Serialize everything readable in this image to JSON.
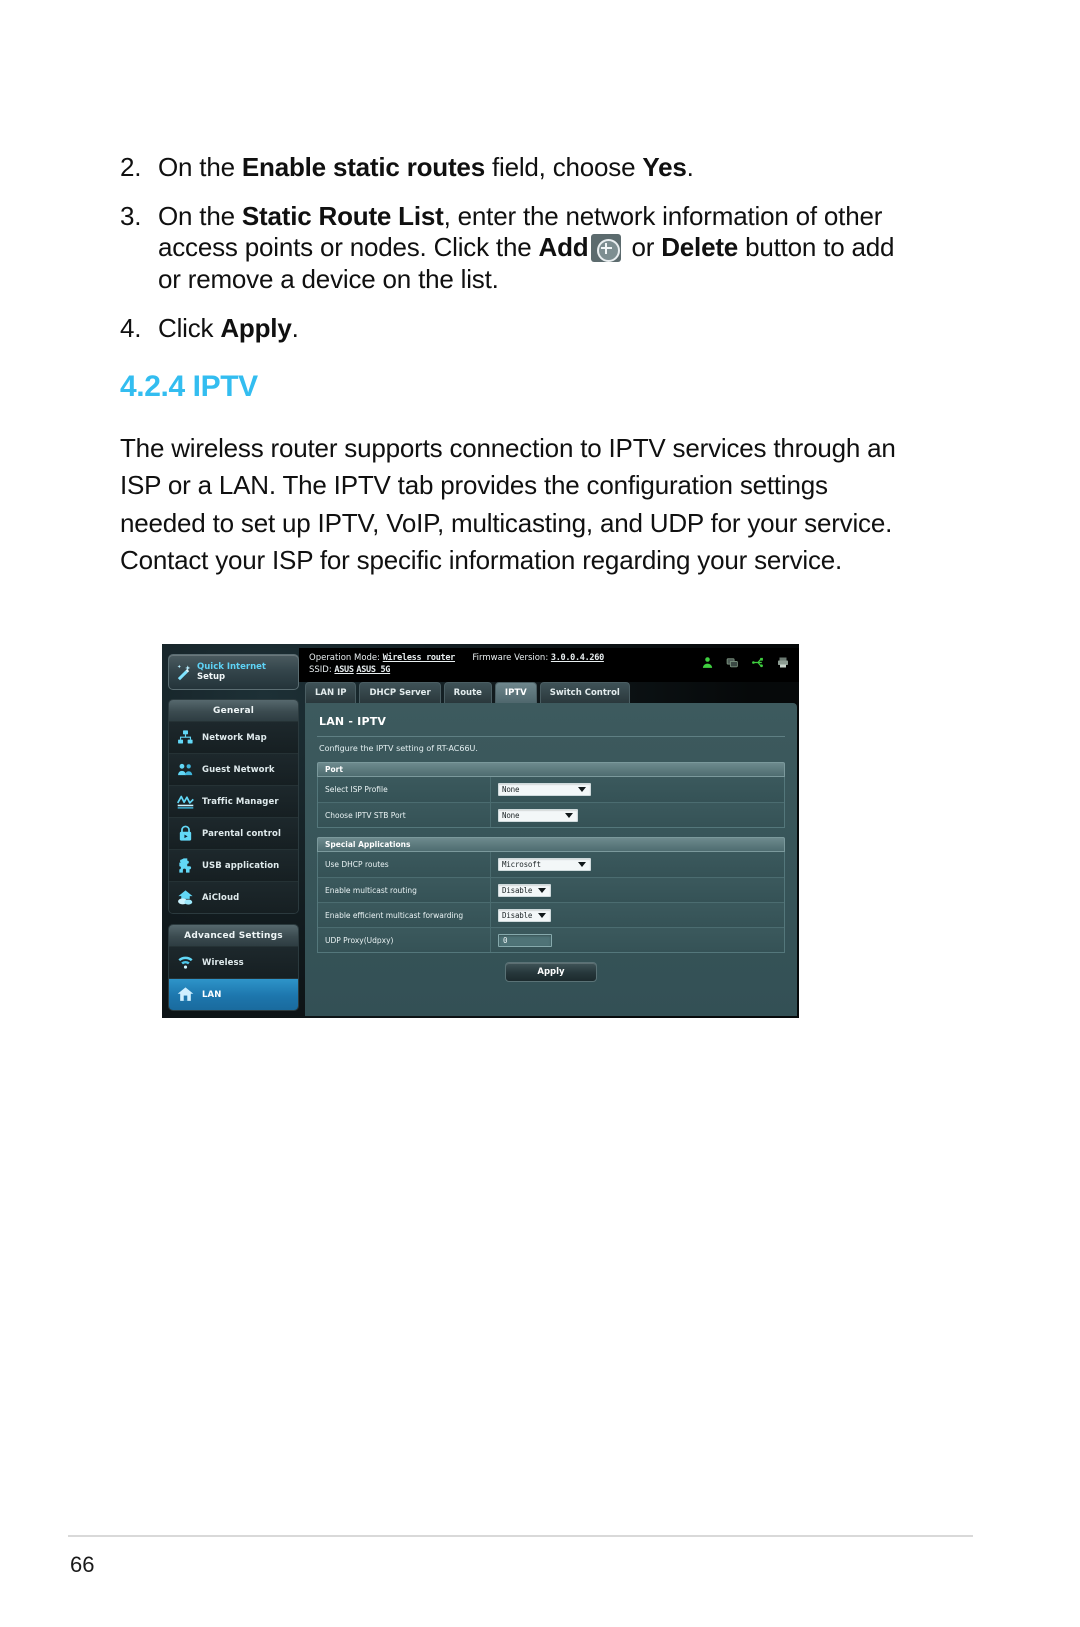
{
  "doc": {
    "page_number": "66",
    "steps": [
      {
        "num": "2.",
        "before": "On the ",
        "bold1": "Enable static routes",
        "mid": " field, choose ",
        "bold2": "Yes",
        "after": "."
      },
      {
        "num": "3.",
        "before": "On the ",
        "bold1": "Static Route List",
        "mid": ", enter the network information of other access points or nodes. Click the ",
        "bold2": "Add",
        "icon_name": "add-circle-icon",
        "mid2": " or ",
        "bold3": "Delete",
        "after": " button to add or remove a device on the list."
      },
      {
        "num": "4.",
        "before": "Click ",
        "bold1": "Apply",
        "after": "."
      }
    ],
    "section_heading": "4.2.4 IPTV",
    "paragraph": "The wireless router supports connection to IPTV services through an ISP or a LAN. The IPTV tab provides the configuration settings needed to set up IPTV, VoIP, multicasting, and UDP for your service. Contact your ISP for specific information regarding your service."
  },
  "router_ui": {
    "header": {
      "operation_mode_label": "Operation Mode:",
      "operation_mode_value": "Wireless router",
      "firmware_label": "Firmware Version:",
      "firmware_value": "3.0.0.4.260",
      "ssid_label": "SSID:",
      "ssid_value_1": "ASUS",
      "ssid_value_2": "ASUS_5G",
      "icons": [
        "user-icon",
        "network-icon",
        "usb-icon",
        "printer-icon"
      ]
    },
    "sidebar": {
      "quick_setup": {
        "line1": "Quick Internet",
        "line2": "Setup",
        "icon": "magic-wand-icon"
      },
      "groups": [
        {
          "title": "General",
          "items": [
            {
              "label": "Network Map",
              "icon": "network-map-icon",
              "active": false
            },
            {
              "label": "Guest Network",
              "icon": "guest-network-icon",
              "active": false
            },
            {
              "label": "Traffic Manager",
              "icon": "traffic-manager-icon",
              "active": false
            },
            {
              "label": "Parental control",
              "icon": "lock-icon",
              "active": false
            },
            {
              "label": "USB application",
              "icon": "puzzle-icon",
              "active": false
            },
            {
              "label": "AiCloud",
              "icon": "cloud-home-icon",
              "active": false
            }
          ]
        },
        {
          "title": "Advanced Settings",
          "items": [
            {
              "label": "Wireless",
              "icon": "wifi-icon",
              "active": false
            },
            {
              "label": "LAN",
              "icon": "home-icon",
              "active": true
            }
          ]
        }
      ]
    },
    "tabs": [
      {
        "label": "LAN IP",
        "active": false
      },
      {
        "label": "DHCP Server",
        "active": false
      },
      {
        "label": "Route",
        "active": false
      },
      {
        "label": "IPTV",
        "active": true
      },
      {
        "label": "Switch Control",
        "active": false
      }
    ],
    "panel": {
      "title": "LAN - IPTV",
      "description": "Configure the IPTV setting of RT-AC66U.",
      "sections": [
        {
          "title": "Port",
          "rows": [
            {
              "label": "Select ISP Profile",
              "control": "select",
              "value": "None",
              "width": "wide"
            },
            {
              "label": "Choose IPTV STB Port",
              "control": "select",
              "value": "None",
              "width": "med"
            }
          ]
        },
        {
          "title": "Special Applications",
          "rows": [
            {
              "label": "Use DHCP routes",
              "control": "select",
              "value": "Microsoft",
              "width": "wide"
            },
            {
              "label": "Enable multicast routing",
              "control": "select",
              "value": "Disable",
              "width": "auto"
            },
            {
              "label": "Enable efficient multicast forwarding",
              "control": "select",
              "value": "Disable",
              "width": "auto"
            },
            {
              "label": "UDP Proxy(Udpxy)",
              "control": "text",
              "value": "0",
              "width": "auto"
            }
          ]
        }
      ],
      "apply_label": "Apply"
    }
  },
  "colors": {
    "heading_blue": "#33bdf0",
    "panel_teal": "#3a585c",
    "active_menu_blue": "#1d76ad",
    "icon_cyan": "#5ed2f5",
    "status_green": "#3fcf3f"
  }
}
